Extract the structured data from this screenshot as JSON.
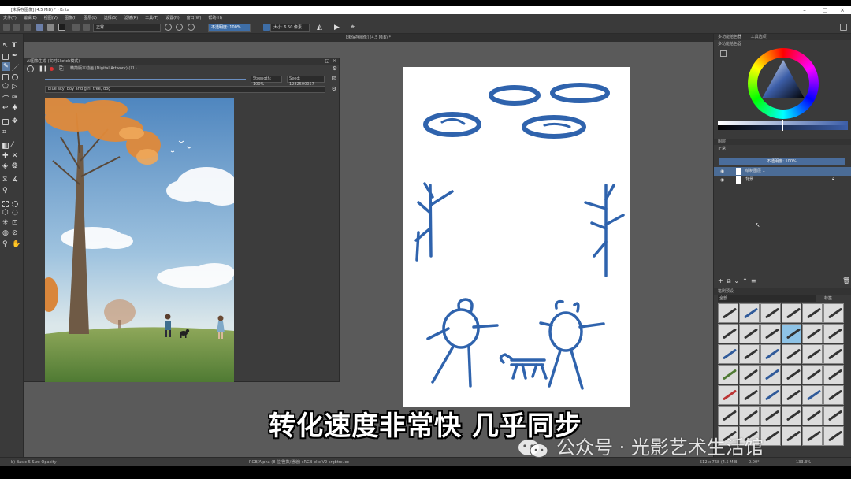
{
  "window": {
    "title": "[未保存图像] (4.5 MiB) * - Krita"
  },
  "menu": [
    "文件(F)",
    "编辑(E)",
    "视图(V)",
    "图像(I)",
    "图层(L)",
    "选择(S)",
    "滤镜(R)",
    "工具(T)",
    "设置(N)",
    "窗口(W)",
    "帮助(H)"
  ],
  "toolbar": {
    "blend_mode": "正常",
    "opacity": "不透明度: 100%",
    "size_label": "大小: 6.50 像素"
  },
  "document_tab": "[未保存图像] (4.5 MiB) *",
  "ai_docker": {
    "title": "AI图像生成 (实时Sketch模式)",
    "mode": "精简版本动画 (Digital Artwork) (XL)",
    "strength": "Strength: 100%",
    "seed": "Seed: 1282500057",
    "prompt": "blue sky, boy and girl, tree, dog"
  },
  "right_panel": {
    "color_tab": "多功能拾色器",
    "color_tab2": "工具选项",
    "color_sub": "多功能拾色器",
    "layers_title": "图层",
    "layers_blend": "正常",
    "layers_opacity": "不透明度: 100%",
    "layers": [
      {
        "name": "绘制图层 1",
        "selected": true
      },
      {
        "name": "背景",
        "selected": false
      }
    ],
    "brush_title": "笔刷预设",
    "brush_filter": "全部",
    "brush_tag": "标签"
  },
  "statusbar": {
    "brush": "b) Basic-5 Size Opacity",
    "colorspace": "RGB/Alpha (8 位/整数/通道)  sRGB-elle-V2-srgbtrc.icc",
    "dims": "512 x 768 (4.5 MiB)",
    "rotation": "0.00°",
    "zoom": "133.3%"
  },
  "subtitle": "转化速度非常快 几乎同步",
  "watermark": "公众号 · 光影艺术生活馆",
  "colors": {
    "stroke": "#2f63ad",
    "accent": "#3e6ea7",
    "panel": "#3a3a3a",
    "canvas_bg": "#5a5a5a"
  }
}
